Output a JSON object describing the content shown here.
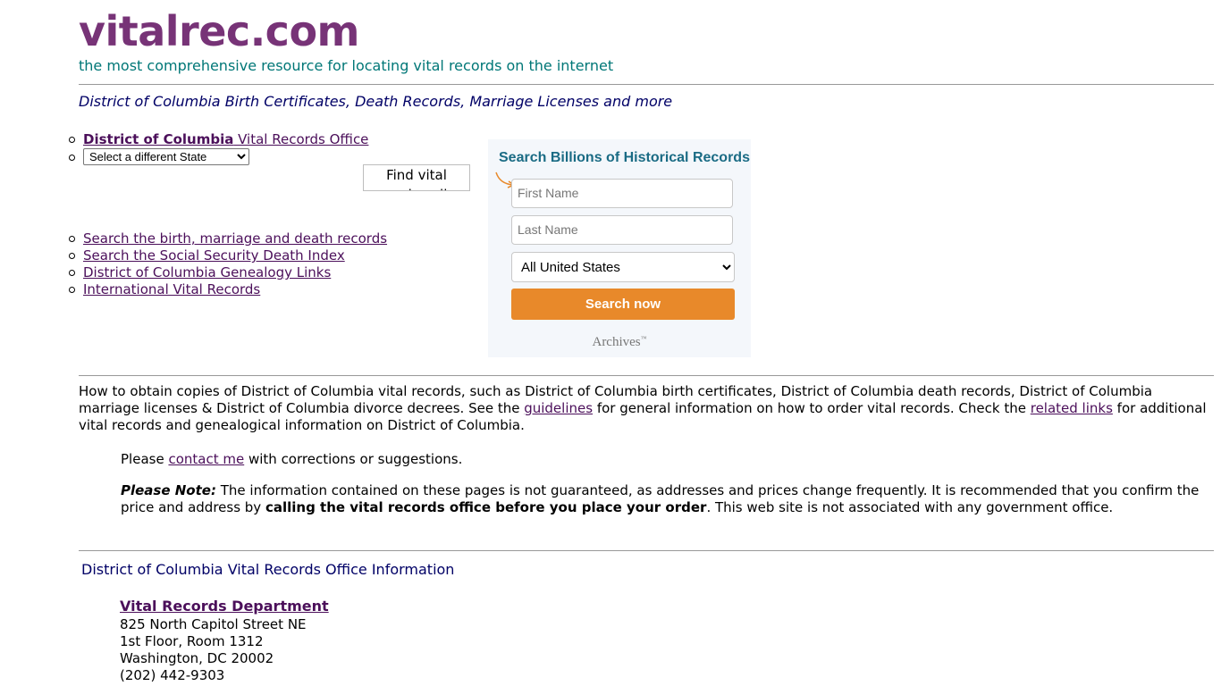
{
  "site": {
    "logo": "vitalrec.com",
    "tagline": "the most comprehensive resource for locating vital records on the internet"
  },
  "page_heading": "District of Columbia Birth Certificates, Death Records, Marriage Licenses and more",
  "top_links": {
    "office_link_bold": "District of Columbia",
    "office_link_rest": " Vital Records Office",
    "state_select_value": "Select a different State"
  },
  "image_alt": "Find vital records online",
  "resource_links": [
    "Search the birth, marriage and death records",
    "Search the Social Security Death Index",
    "District of Columbia Genealogy Links",
    "International Vital Records"
  ],
  "search_widget": {
    "title": "Search Billions of Historical Records",
    "first_name_placeholder": "First Name",
    "last_name_placeholder": "Last Name",
    "location_value": "All United States",
    "button_label": "Search now",
    "brand": "Archives",
    "brand_mark": "™",
    "accent_color": "#e8892a",
    "title_color": "#1a6b84"
  },
  "intro": {
    "part1": "How to obtain copies of District of Columbia vital records, such as District of Columbia birth certificates, District of Columbia death records, District of Columbia marriage licenses & District of Columbia divorce decrees. See the ",
    "guidelines_link": "guidelines",
    "part2": " for general information on how to order vital records. Check the ",
    "related_link": "related links",
    "part3": " for additional vital records and genealogical information on District of Columbia."
  },
  "contact": {
    "prefix": "Please ",
    "link": "contact me",
    "suffix": " with corrections or suggestions."
  },
  "note": {
    "label": "Please Note:",
    "text1": " The information contained on these pages is not guaranteed, as addresses and prices change frequently. It is recommended that you confirm the price and address by ",
    "bold": "calling the vital records office before you place your order",
    "text2": ". This web site is not associated with any government office."
  },
  "office": {
    "section_title": "District of Columbia Vital Records Office Information",
    "name": "Vital Records Department",
    "address_lines": [
      "825 North Capitol Street NE",
      "1st Floor, Room 1312",
      "Washington, DC 20002",
      "(202) 442-9303"
    ]
  }
}
